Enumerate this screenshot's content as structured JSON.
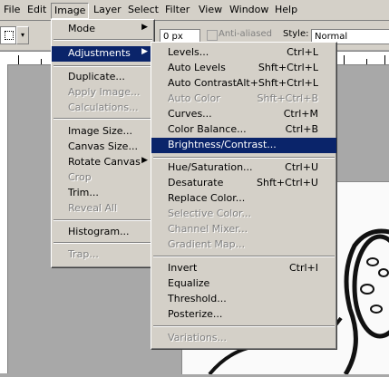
{
  "menubar": {
    "items": [
      "File",
      "Edit",
      "Image",
      "Layer",
      "Select",
      "Filter",
      "View",
      "Window",
      "Help"
    ],
    "active": "Image"
  },
  "options": {
    "width_value": "0 px",
    "antialiased_label": "Anti-aliased",
    "style_label": "Style:",
    "style_value": "Normal",
    "marquee_arrow": "▾"
  },
  "image_menu": {
    "mode": "Mode",
    "adjustments": "Adjustments",
    "duplicate": "Duplicate...",
    "apply_image": "Apply Image...",
    "calculations": "Calculations...",
    "image_size": "Image Size...",
    "canvas_size": "Canvas Size...",
    "rotate_canvas": "Rotate Canvas",
    "crop": "Crop",
    "trim": "Trim...",
    "reveal_all": "Reveal All",
    "histogram": "Histogram...",
    "trap": "Trap...",
    "submenu_arrow": "▶"
  },
  "adjust_menu": {
    "levels": "Levels...",
    "levels_sc": "Ctrl+L",
    "auto_levels": "Auto Levels",
    "auto_levels_sc": "Shft+Ctrl+L",
    "auto_contrast": "Auto Contrast",
    "auto_contrast_sc": "Alt+Shft+Ctrl+L",
    "auto_color": "Auto Color",
    "auto_color_sc": "Shft+Ctrl+B",
    "curves": "Curves...",
    "curves_sc": "Ctrl+M",
    "color_balance": "Color Balance...",
    "color_balance_sc": "Ctrl+B",
    "brightness_contrast": "Brightness/Contrast...",
    "hue_saturation": "Hue/Saturation...",
    "hue_saturation_sc": "Ctrl+U",
    "desaturate": "Desaturate",
    "desaturate_sc": "Shft+Ctrl+U",
    "replace_color": "Replace Color...",
    "selective_color": "Selective Color...",
    "channel_mixer": "Channel Mixer...",
    "gradient_map": "Gradient Map...",
    "invert": "Invert",
    "invert_sc": "Ctrl+I",
    "equalize": "Equalize",
    "threshold": "Threshold...",
    "posterize": "Posterize...",
    "variations": "Variations..."
  },
  "colors": {
    "highlight": "#0a246a",
    "menu_bg": "#d4d0c8",
    "workspace": "#a8a8a8"
  }
}
